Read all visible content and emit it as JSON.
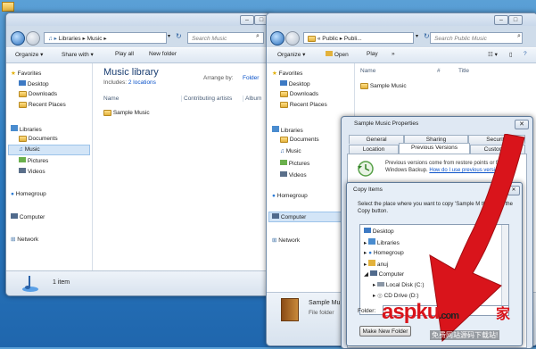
{
  "desktop": {
    "icon": "folder-icon"
  },
  "window1": {
    "controls": {
      "min": "–",
      "max": "□"
    },
    "address": {
      "path": [
        "Libraries",
        "Music"
      ]
    },
    "search_placeholder": "Search Music",
    "toolbar": {
      "organize": "Organize ▾",
      "share": "Share with ▾",
      "play": "Play all",
      "new_folder": "New folder"
    },
    "nav": {
      "favorites": "Favorites",
      "desktop": "Desktop",
      "downloads": "Downloads",
      "recent": "Recent Places",
      "libraries": "Libraries",
      "documents": "Documents",
      "music": "Music",
      "pictures": "Pictures",
      "videos": "Videos",
      "homegroup": "Homegroup",
      "computer": "Computer",
      "network": "Network"
    },
    "library_title": "Music library",
    "includes_prefix": "Includes:",
    "includes_link": "2 locations",
    "arrange_label": "Arrange by:",
    "arrange_value": "Folder",
    "columns": [
      "Name",
      "Contributing artists",
      "Album"
    ],
    "items": [
      "Sample Music"
    ],
    "status": "1 item"
  },
  "window2": {
    "address": {
      "path": [
        "«",
        "Public",
        "Publi..."
      ]
    },
    "search_placeholder": "Search Public Music",
    "toolbar": {
      "organize": "Organize ▾",
      "open": "Open",
      "play": "Play",
      "more": "»"
    },
    "nav": {
      "favorites": "Favorites",
      "desktop": "Desktop",
      "downloads": "Downloads",
      "recent": "Recent Places",
      "libraries": "Libraries",
      "documents": "Documents",
      "music": "Music",
      "pictures": "Pictures",
      "videos": "Videos",
      "homegroup": "Homegroup",
      "computer": "Computer",
      "network": "Network"
    },
    "columns": [
      "Name",
      "#",
      "Title"
    ],
    "items": [
      "Sample Music"
    ],
    "details": {
      "name": "Sample Mu",
      "type": "File folder"
    }
  },
  "properties": {
    "title": "Sample Music Properties",
    "tabs_row1": [
      "General",
      "Sharing",
      "Security"
    ],
    "tabs_row2": [
      "Location",
      "Previous Versions",
      "Customize"
    ],
    "info_text": "Previous versions come from restore points or from Windows Backup.",
    "info_link": "How do I use previous versions?"
  },
  "copy_dialog": {
    "title": "Copy Items",
    "instructions": "Select the place where you want to copy 'Sample M then click the Copy button.",
    "tree": [
      "Desktop",
      "Libraries",
      "Homegroup",
      "anuj",
      "Computer",
      "Local Disk (C:)",
      "CD Drive (D:)"
    ],
    "folder_label": "Folder:",
    "make_new_folder": "Make New Folder"
  },
  "watermark": {
    "brand": "aspku",
    "suffix": ".com",
    "tagline": "免费网站源码下载站!",
    "cjk": "家"
  },
  "colors": {
    "accent": "#1a5fb4",
    "arrow": "#d9141b",
    "link": "#0a52c9"
  }
}
